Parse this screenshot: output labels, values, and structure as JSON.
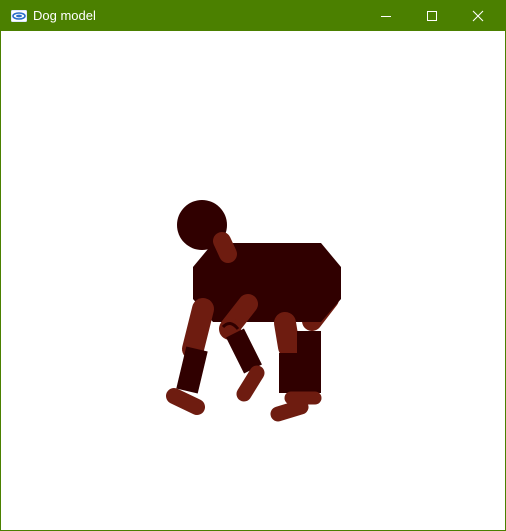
{
  "window": {
    "title": "Dog model",
    "titlebar_color": "#4b8000",
    "app_icon": "opengl-app-icon"
  },
  "controls": {
    "minimize_icon": "minimize-icon",
    "maximize_icon": "maximize-icon",
    "close_icon": "close-icon"
  },
  "scene": {
    "background": "#ffffff",
    "body_color": "#300000",
    "limb_color": "#6e1c10"
  }
}
